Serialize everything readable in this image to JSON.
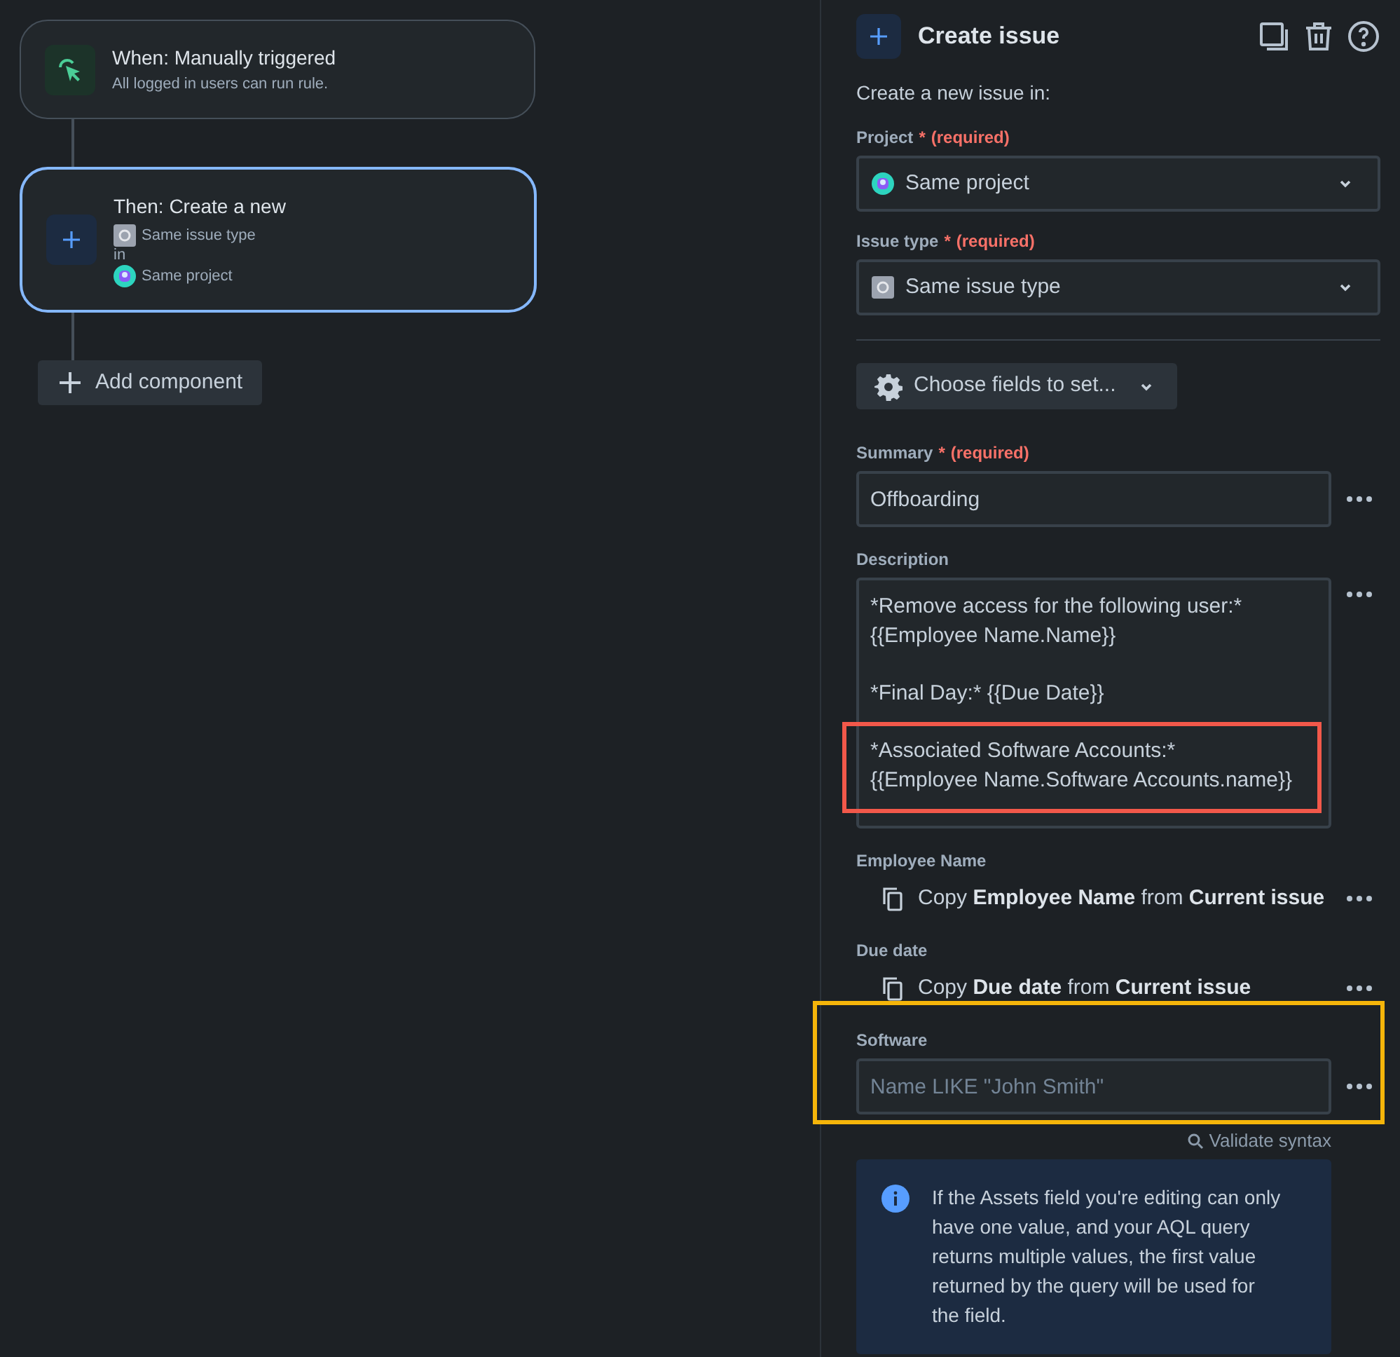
{
  "rule": {
    "trigger": {
      "title": "When: Manually triggered",
      "subtitle": "All logged in users can run rule."
    },
    "action": {
      "title": "Then: Create a new",
      "issue_type": "Same issue type",
      "joiner": "in",
      "project": "Same project",
      "selected": true
    },
    "add_button": "Add component"
  },
  "panel": {
    "title": "Create issue",
    "intro": "Create a new issue in:",
    "selects": [
      {
        "label": "Project",
        "required_mark": "*",
        "required_text": "(required)",
        "value": "Same project",
        "kind": "project"
      },
      {
        "label": "Issue type",
        "required_mark": "*",
        "required_text": "(required)",
        "value": "Same issue type",
        "kind": "issuetype"
      }
    ],
    "choose_fields": "Choose fields to set...",
    "fields": [
      {
        "kind": "input",
        "label": "Summary",
        "required_mark": "*",
        "required_text": "(required)",
        "value": "Offboarding"
      },
      {
        "kind": "textarea",
        "label": "Description",
        "paragraphs": [
          {
            "lines": [
              "*Remove access for the following user:*",
              "{{Employee Name.Name}}"
            ]
          },
          {
            "lines": [
              "*Final Day:* {{Due Date}}"
            ]
          },
          {
            "lines": [
              "*Associated Software Accounts:*",
              "{{Employee Name.Software Accounts.name}}"
            ],
            "highlighted": true
          }
        ]
      },
      {
        "kind": "copy",
        "label": "Employee Name",
        "text": "Copy **Employee Name** from **Current issue**"
      },
      {
        "kind": "copy",
        "label": "Due date",
        "text": "Copy **Due date** from **Current issue**"
      },
      {
        "kind": "input",
        "label": "Software",
        "placeholder": "Name LIKE \"John Smith\"",
        "highlighted": true
      }
    ],
    "validate": "Validate syntax",
    "info": "If the Assets field you're editing can only have one value, and your AQL query returns multiple values, the first value returned by the query will be used for the field."
  }
}
